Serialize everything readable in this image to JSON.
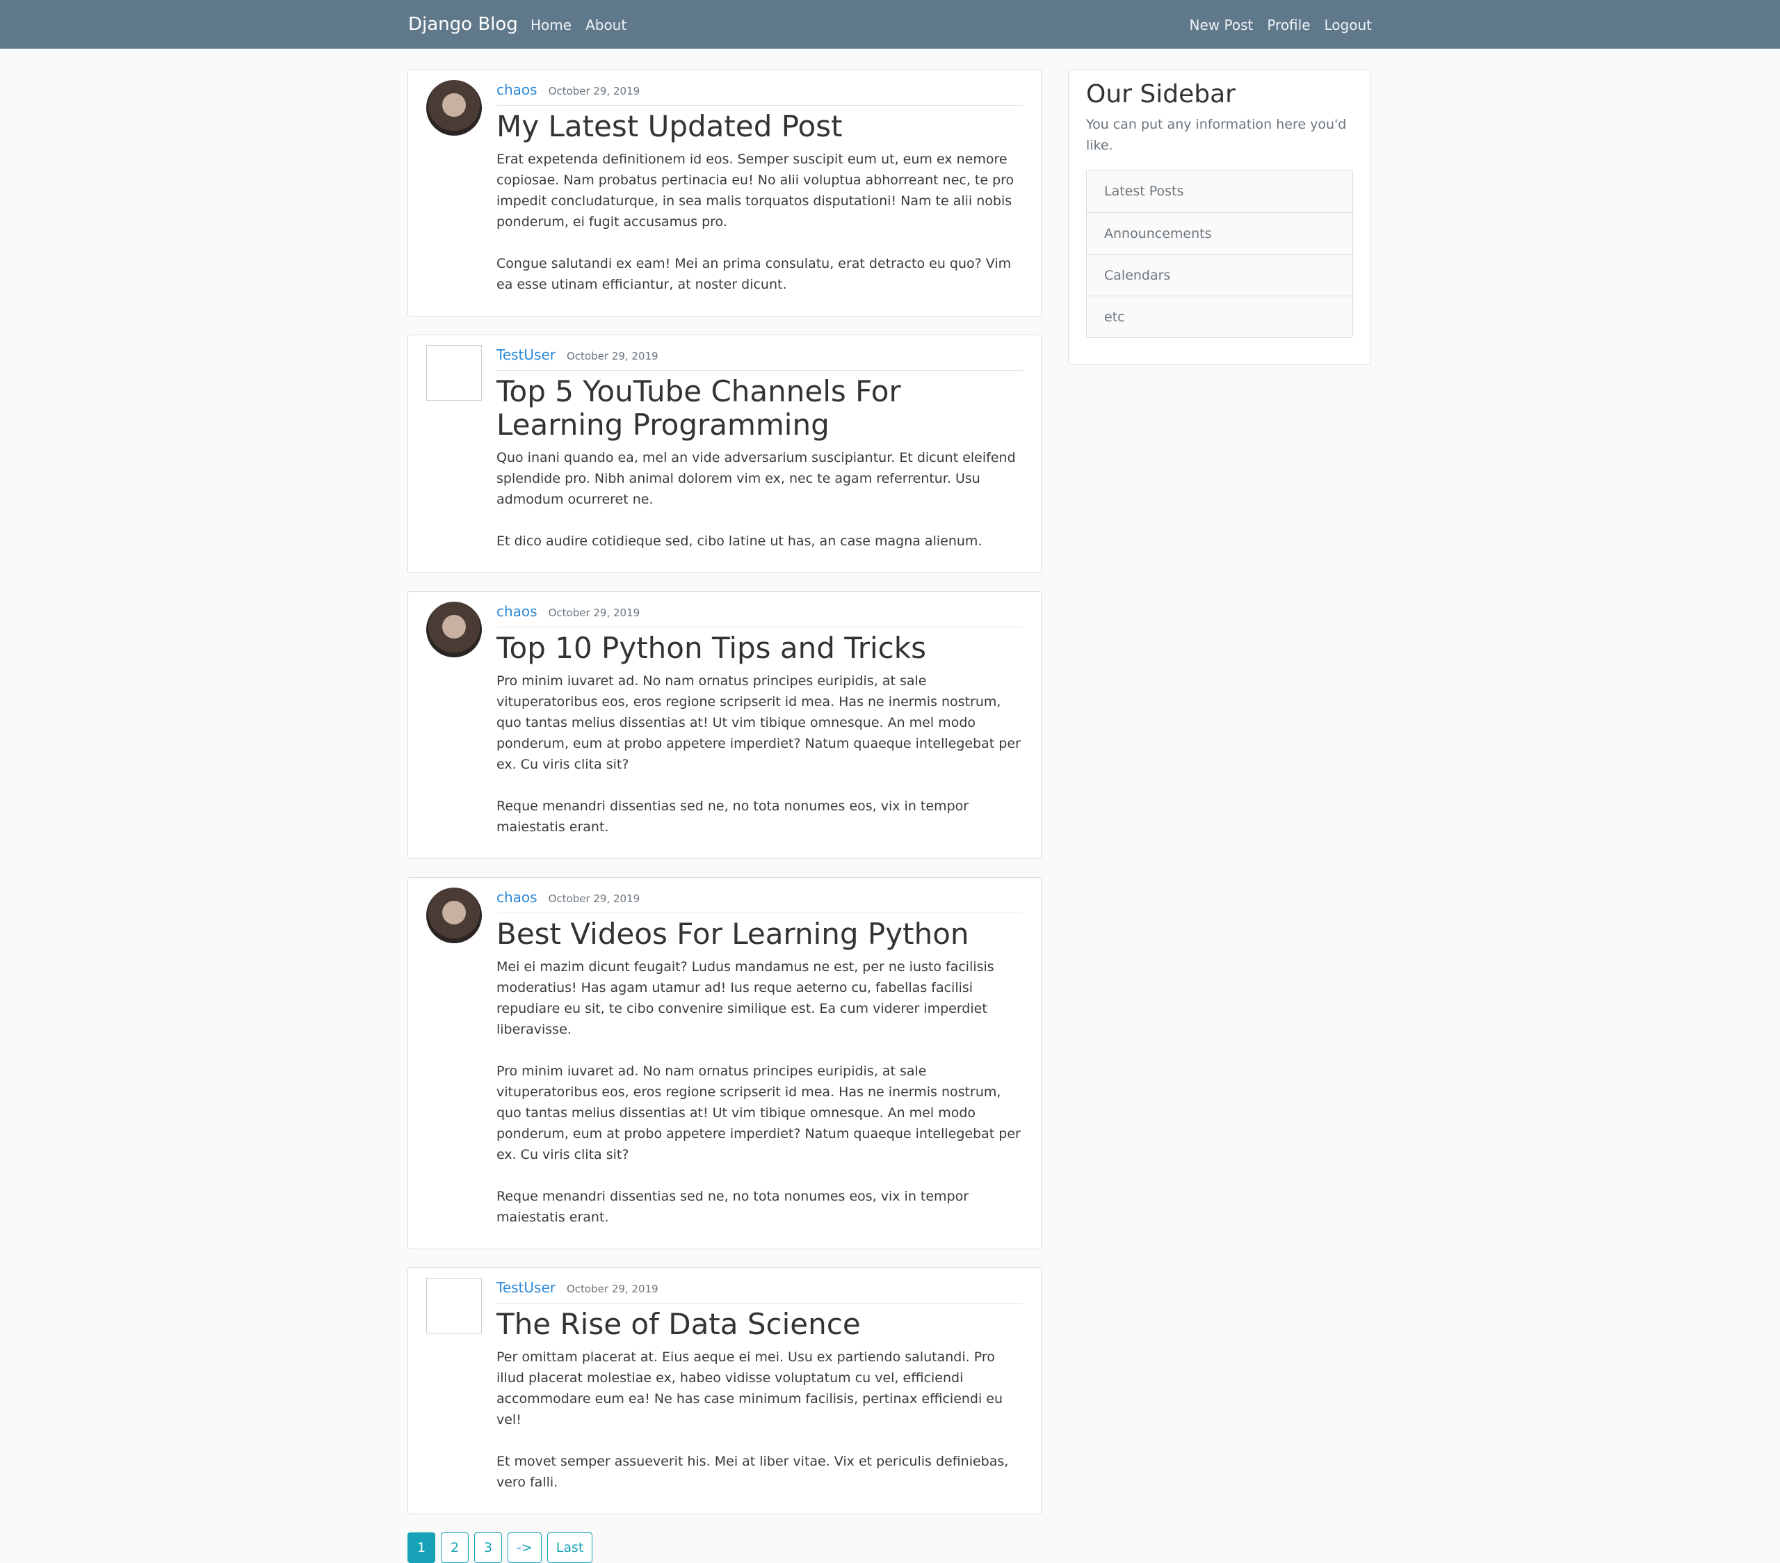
{
  "navbar": {
    "brand": "Django Blog",
    "left_links": [
      "Home",
      "About"
    ],
    "right_links": [
      "New Post",
      "Profile",
      "Logout"
    ]
  },
  "posts": [
    {
      "author": "chaos",
      "date": "October 29, 2019",
      "title": "My Latest Updated Post",
      "avatar": "photo",
      "paragraphs": [
        "Erat expetenda definitionem id eos. Semper suscipit eum ut, eum ex nemore copiosae. Nam probatus pertinacia eu! No alii voluptua abhorreant nec, te pro impedit concludaturque, in sea malis torquatos disputationi! Nam te alii nobis ponderum, ei fugit accusamus pro.",
        "Congue salutandi ex eam! Mei an prima consulatu, erat detracto eu quo? Vim ea esse utinam efficiantur, at noster dicunt."
      ]
    },
    {
      "author": "TestUser",
      "date": "October 29, 2019",
      "title": "Top 5 YouTube Channels For Learning Programming",
      "avatar": "broken-image",
      "paragraphs": [
        "Quo inani quando ea, mel an vide adversarium suscipiantur. Et dicunt eleifend splendide pro. Nibh animal dolorem vim ex, nec te agam referrentur. Usu admodum ocurreret ne.",
        "Et dico audire cotidieque sed, cibo latine ut has, an case magna alienum."
      ]
    },
    {
      "author": "chaos",
      "date": "October 29, 2019",
      "title": "Top 10 Python Tips and Tricks",
      "avatar": "photo",
      "paragraphs": [
        "Pro minim iuvaret ad. No nam ornatus principes euripidis, at sale vituperatoribus eos, eros regione scripserit id mea. Has ne inermis nostrum, quo tantas melius dissentias at! Ut vim tibique omnesque. An mel modo ponderum, eum at probo appetere imperdiet? Natum quaeque intellegebat per ex. Cu viris clita sit?",
        "Reque menandri dissentias sed ne, no tota nonumes eos, vix in tempor maiestatis erant."
      ]
    },
    {
      "author": "chaos",
      "date": "October 29, 2019",
      "title": "Best Videos For Learning Python",
      "avatar": "photo",
      "paragraphs": [
        "Mei ei mazim dicunt feugait? Ludus mandamus ne est, per ne iusto facilisis moderatius! Has agam utamur ad! Ius reque aeterno cu, fabellas facilisi repudiare eu sit, te cibo convenire similique est. Ea cum viderer imperdiet liberavisse.",
        "Pro minim iuvaret ad. No nam ornatus principes euripidis, at sale vituperatoribus eos, eros regione scripserit id mea. Has ne inermis nostrum, quo tantas melius dissentias at! Ut vim tibique omnesque. An mel modo ponderum, eum at probo appetere imperdiet? Natum quaeque intellegebat per ex. Cu viris clita sit?",
        "Reque menandri dissentias sed ne, no tota nonumes eos, vix in tempor maiestatis erant."
      ]
    },
    {
      "author": "TestUser",
      "date": "October 29, 2019",
      "title": "The Rise of Data Science",
      "avatar": "broken-image",
      "paragraphs": [
        "Per omittam placerat at. Eius aeque ei mei. Usu ex partiendo salutandi. Pro illud placerat molestiae ex, habeo vidisse voluptatum cu vel, efficiendi accommodare eum ea! Ne has case minimum facilisis, pertinax efficiendi eu vel!",
        "Et movet semper assueverit his. Mei at liber vitae. Vix et periculis definiebas, vero falli."
      ]
    }
  ],
  "pagination": [
    "1",
    "2",
    "3",
    "->",
    "Last"
  ],
  "pagination_active": "1",
  "sidebar": {
    "title": "Our Sidebar",
    "description": "You can put any information here you'd like.",
    "items": [
      "Latest Posts",
      "Announcements",
      "Calendars",
      "etc"
    ]
  },
  "colors": {
    "navbar_bg": "#5f788a",
    "link": "#2a88d8",
    "pagination_accent": "#17a2b8",
    "page_bg": "#fafafa"
  }
}
